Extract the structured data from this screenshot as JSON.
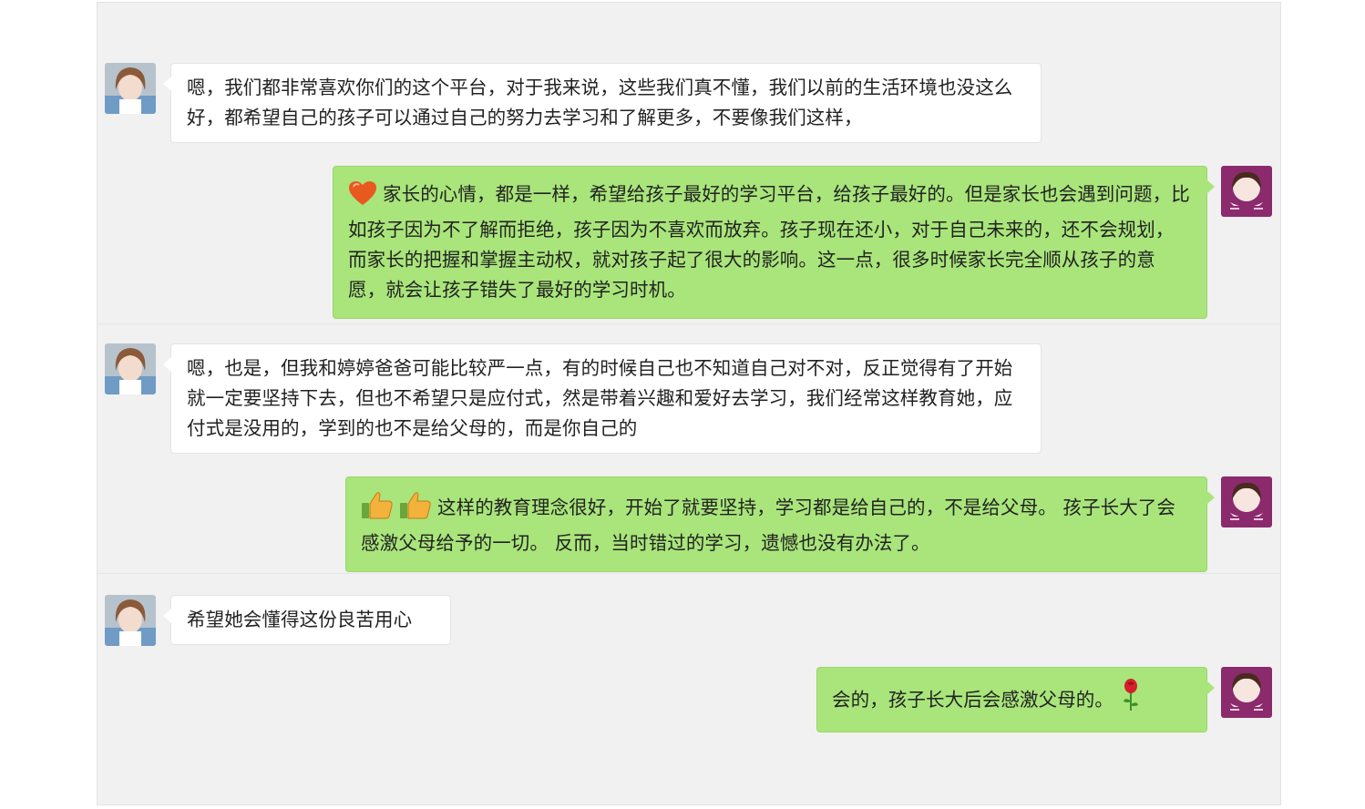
{
  "colors": {
    "panel_bg": "#f1f1f1",
    "incoming_bubble": "#ffffff",
    "outgoing_bubble": "#a9e57b",
    "text": "#222222"
  },
  "messages": [
    {
      "side": "incoming",
      "avatar": "parent-avatar",
      "text": "嗯，我们都非常喜欢你们的这个平台，对于我来说，这些我们真不懂，我们以前的生活环境也没这么好，都希望自己的孩子可以通过自己的努力去学习和了解更多，不要像我们这样，"
    },
    {
      "side": "outgoing",
      "avatar": "teacher-avatar",
      "emoji": [
        "heart-icon"
      ],
      "text": "家长的心情，都是一样，希望给孩子最好的学习平台，给孩子最好的。但是家长也会遇到问题，比如孩子因为不了解而拒绝，孩子因为不喜欢而放弃。孩子现在还小，对于自己未来的，还不会规划，而家长的把握和掌握主动权，就对孩子起了很大的影响。这一点，很多时候家长完全顺从孩子的意愿，就会让孩子错失了最好的学习时机。"
    },
    {
      "side": "incoming",
      "avatar": "parent-avatar",
      "text": "嗯，也是，但我和婷婷爸爸可能比较严一点，有的时候自己也不知道自己对不对，反正觉得有了开始就一定要坚持下去，但也不希望只是应付式，然是带着兴趣和爱好去学习，我们经常这样教育她，应付式是没用的，学到的也不是给父母的，而是你自己的"
    },
    {
      "side": "outgoing",
      "avatar": "teacher-avatar",
      "emoji": [
        "thumbs-up-icon",
        "thumbs-up-icon"
      ],
      "text": "这样的教育理念很好，开始了就要坚持，学习都是给自己的，不是给父母。 孩子长大了会感激父母给予的一切。 反而，当时错过的学习，遗憾也没有办法了。"
    },
    {
      "side": "incoming",
      "avatar": "parent-avatar",
      "text": "希望她会懂得这份良苦用心"
    },
    {
      "side": "outgoing",
      "avatar": "teacher-avatar",
      "emoji_after": [
        "rose-icon"
      ],
      "text": "会的，孩子长大后会感激父母的。"
    }
  ]
}
